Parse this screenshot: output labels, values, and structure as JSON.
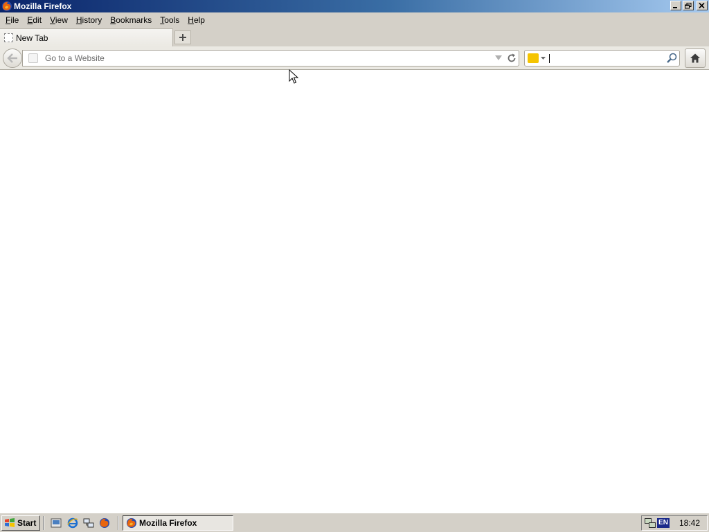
{
  "window": {
    "title": "Mozilla Firefox"
  },
  "menu": [
    {
      "label": "File",
      "accel": "F",
      "rest": "ile"
    },
    {
      "label": "Edit",
      "accel": "E",
      "rest": "dit"
    },
    {
      "label": "View",
      "accel": "V",
      "rest": "iew"
    },
    {
      "label": "History",
      "accel": "H",
      "rest": "istory"
    },
    {
      "label": "Bookmarks",
      "accel": "B",
      "rest": "ookmarks"
    },
    {
      "label": "Tools",
      "accel": "T",
      "rest": "ools"
    },
    {
      "label": "Help",
      "accel": "H",
      "rest": "elp"
    }
  ],
  "tabs": [
    {
      "label": "New Tab",
      "active": true
    }
  ],
  "urlbar": {
    "value": "",
    "placeholder": "Go to a Website"
  },
  "searchbar": {
    "value": "",
    "engine_icon": "yahoo-engine-icon"
  },
  "taskbar": {
    "start_label": "Start",
    "task_label": "Mozilla Firefox",
    "tray_lang": "EN",
    "clock": "18:42"
  }
}
